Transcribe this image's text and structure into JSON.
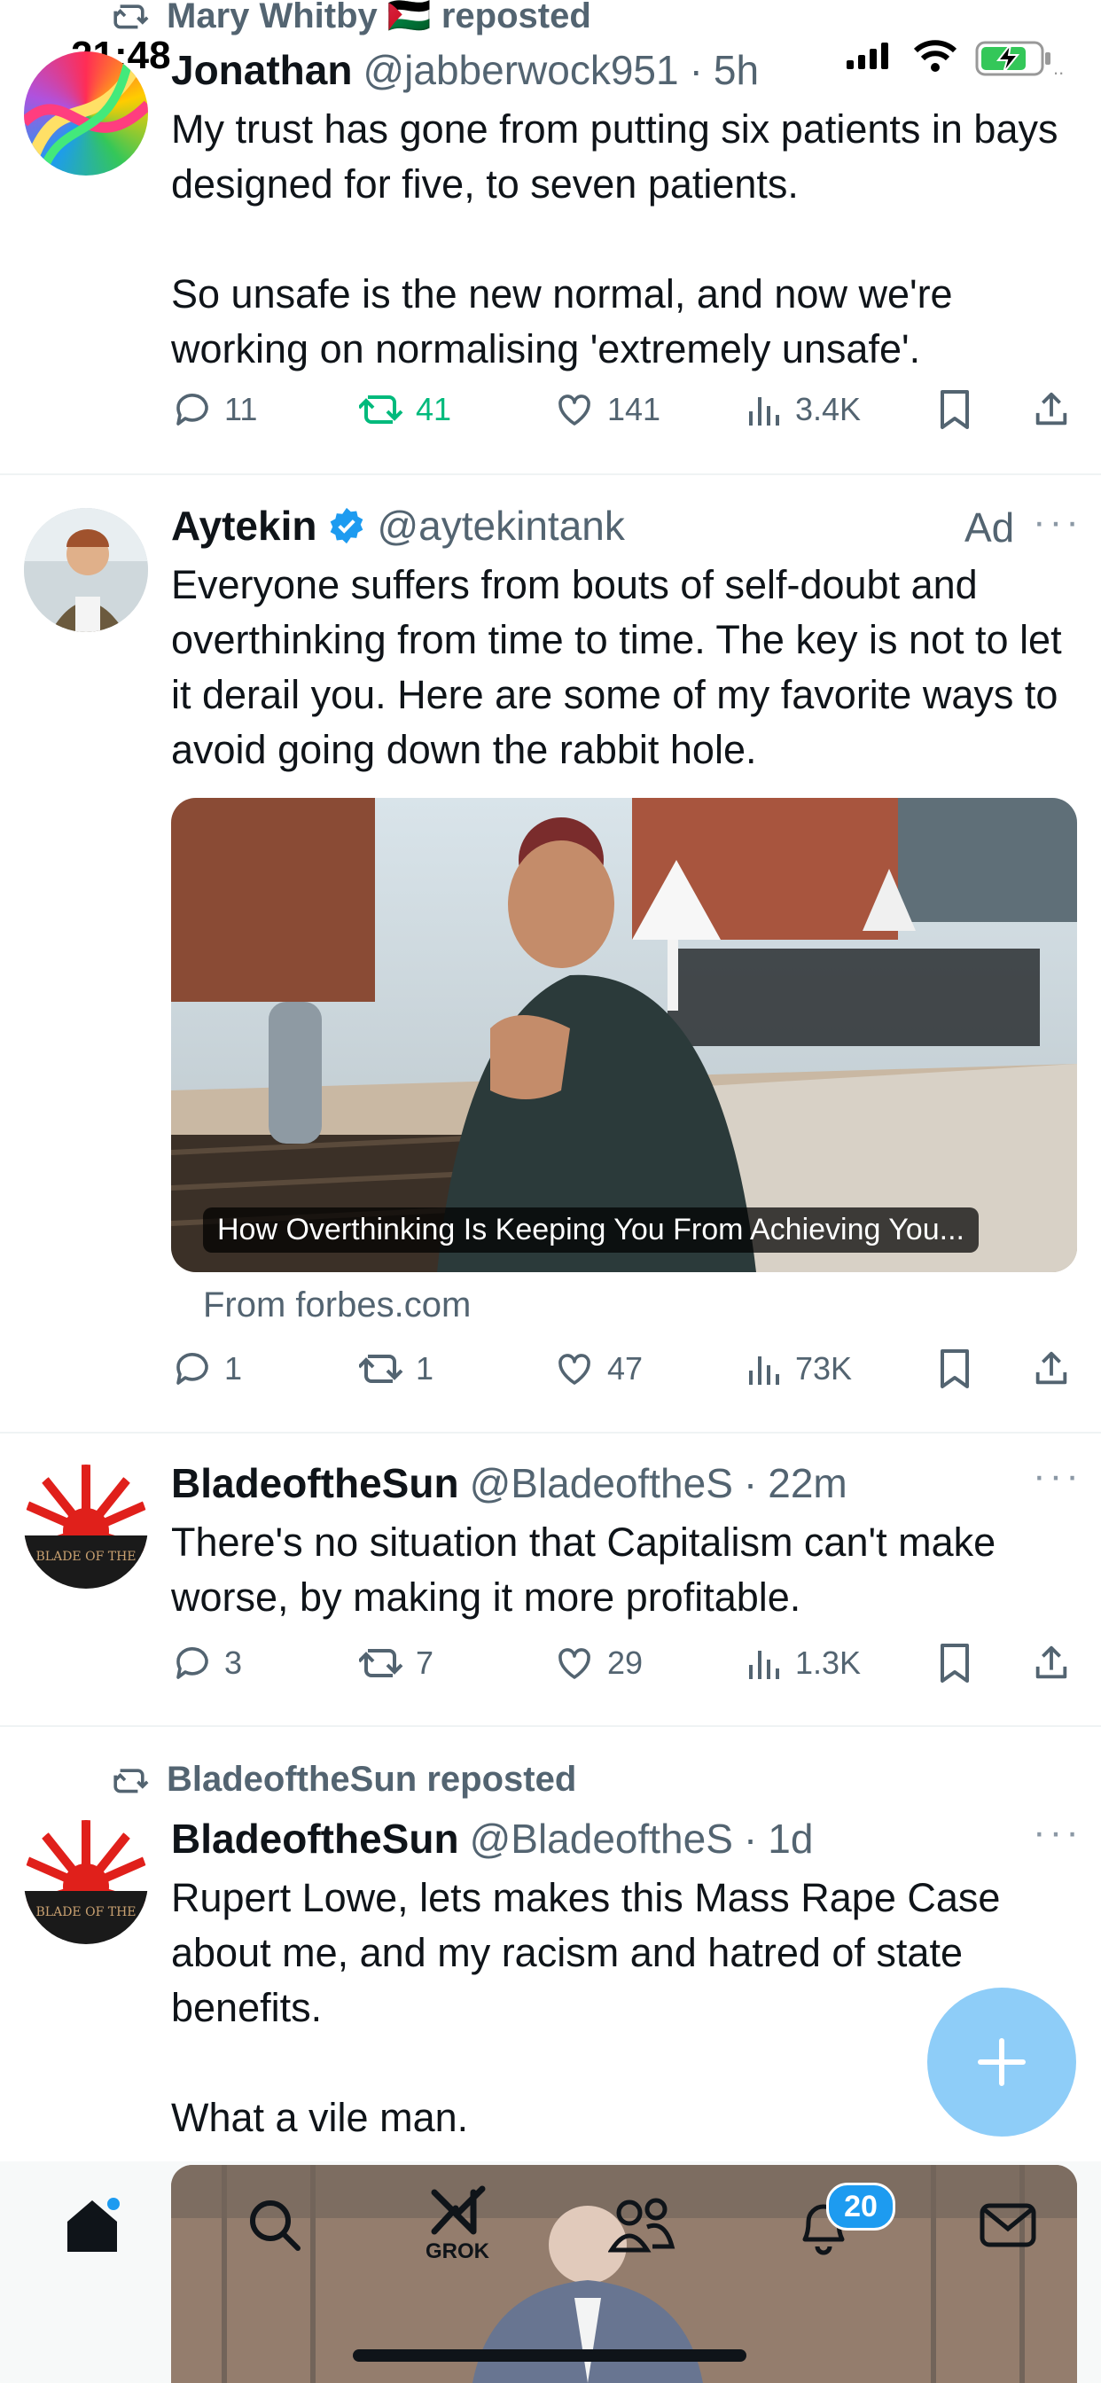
{
  "status_bar": {
    "time": "21:48"
  },
  "tweets": [
    {
      "repost_by": "Mary Whitby 🇵🇸 reposted",
      "name": "Jonathan",
      "handle": "@jabberwock951",
      "sep": "·",
      "time": "5h",
      "text": "My trust has gone from putting six patients in bays designed for five, to seven patients.\n\nSo unsafe is the new normal, and now we're working on normalising 'extremely unsafe'.",
      "replies": "11",
      "reposts": "41",
      "likes": "141",
      "views": "3.4K"
    },
    {
      "name": "Aytekin",
      "handle": "@aytekintank",
      "ad_label": "Ad",
      "text": "Everyone suffers from bouts of self-doubt and overthinking from time to time. The key is not to let it derail you. Here are some of my favorite ways to avoid going down the rabbit hole.",
      "card_title": "How Overthinking Is Keeping You From Achieving You...",
      "card_source": "From forbes.com",
      "replies": "1",
      "reposts": "1",
      "likes": "47",
      "views": "73K"
    },
    {
      "name": "BladeoftheSun",
      "handle": "@BladeoftheS",
      "sep": "·",
      "time": "22m",
      "text": "There's no situation that Capitalism can't make worse, by making it more profitable.",
      "replies": "3",
      "reposts": "7",
      "likes": "29",
      "views": "1.3K"
    },
    {
      "repost_by": "BladeoftheSun reposted",
      "name": "BladeoftheSun",
      "handle": "@BladeoftheS",
      "sep": "·",
      "time": "1d",
      "text": "Rupert Lowe, lets makes this Mass Rape Case about me, and my racism and hatred of state benefits.\n\nWhat a vile man."
    }
  ],
  "avatar_text": {
    "blade": "BLADE OF THE"
  },
  "tabbar": {
    "grok_label": "GROK",
    "notification_count": "20"
  },
  "colors": {
    "accent": "#1d9bf0",
    "repost_active": "#00ba7c",
    "secondary_text": "#536471",
    "fab": "#8ecdf8"
  },
  "icons": [
    "home-icon",
    "search-icon",
    "grok-icon",
    "communities-icon",
    "notifications-icon",
    "messages-icon",
    "reply-icon",
    "repost-icon",
    "like-icon",
    "views-icon",
    "bookmark-icon",
    "share-icon",
    "verified-icon",
    "more-icon",
    "compose-icon"
  ]
}
